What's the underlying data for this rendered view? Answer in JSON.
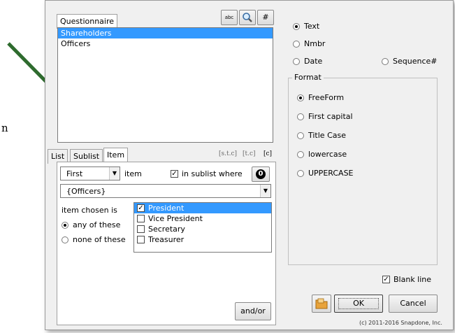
{
  "annotation": {
    "text": "n",
    "arrow_color": "#2e6b2e"
  },
  "questionnaire": {
    "tab_label": "Questionnaire",
    "toolbar": {
      "abc_label": "abc",
      "hash_label": "#"
    },
    "items": [
      "Shareholders",
      "Officers"
    ],
    "selected_index": 0
  },
  "bottom_tabs": {
    "labels": [
      "List",
      "Sublist",
      "Item"
    ],
    "active": "Item",
    "markers": [
      "[s.t.c]",
      "[t.c]",
      "[c]"
    ]
  },
  "item_tab": {
    "position_select": "First",
    "item_label": "item",
    "in_sublist_label": "in sublist where",
    "in_sublist_checked": true,
    "badge": "0",
    "sublist_select": "{Officers}",
    "chosen_label": "item chosen is",
    "any_label": "any of these",
    "none_label": "none of these",
    "choices": [
      {
        "label": "President",
        "checked": true,
        "selected": true
      },
      {
        "label": "Vice President",
        "checked": false,
        "selected": false
      },
      {
        "label": "Secretary",
        "checked": false,
        "selected": false
      },
      {
        "label": "Treasurer",
        "checked": false,
        "selected": false
      }
    ],
    "andor_label": "and/or"
  },
  "type_options": {
    "text": "Text",
    "nmbr": "Nmbr",
    "date": "Date",
    "sequence": "Sequence#",
    "selected": "Text"
  },
  "format": {
    "legend": "Format",
    "options": [
      "FreeForm",
      "First capital",
      "Title Case",
      "lowercase",
      "UPPERCASE"
    ],
    "selected": "FreeForm"
  },
  "blank_line": {
    "label": "Blank line",
    "checked": true
  },
  "buttons": {
    "ok": "OK",
    "cancel": "Cancel"
  },
  "copyright": "(c) 2011-2016 Snapdone, Inc.",
  "colors": {
    "selection": "#3399ff",
    "dialog": "#f0f0f0",
    "folder_icon": "#e8a33a"
  }
}
